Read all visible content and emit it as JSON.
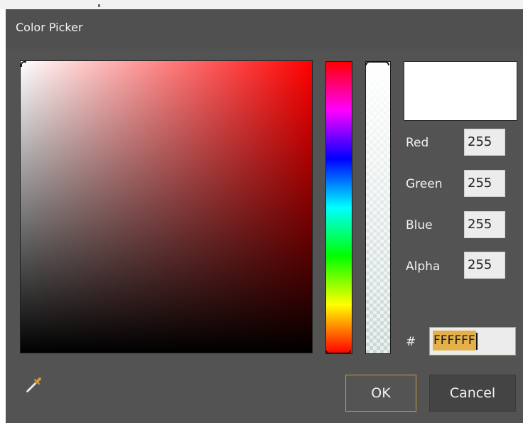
{
  "dialog": {
    "title": "Color Picker"
  },
  "color": {
    "hue_hex": "#ff0000",
    "preview_hex": "#ffffff"
  },
  "channels": [
    {
      "label": "Red",
      "value": "255"
    },
    {
      "label": "Green",
      "value": "255"
    },
    {
      "label": "Blue",
      "value": "255"
    },
    {
      "label": "Alpha",
      "value": "255"
    }
  ],
  "hex": {
    "prefix": "#",
    "value": "FFFFFF"
  },
  "buttons": {
    "ok": "OK",
    "cancel": "Cancel"
  },
  "icons": {
    "eyedropper": "eyedropper-icon"
  },
  "colors": {
    "dialog_bg": "#535353",
    "accent_border": "#c79a3f",
    "selection": "#e4b04a"
  }
}
